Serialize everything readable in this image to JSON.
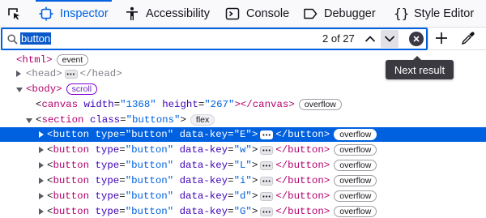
{
  "tabs": [
    {
      "label": "Inspector",
      "icon": "inspector-icon",
      "selected": true
    },
    {
      "label": "Accessibility",
      "icon": "accessibility-icon",
      "selected": false
    },
    {
      "label": "Console",
      "icon": "console-icon",
      "selected": false
    },
    {
      "label": "Debugger",
      "icon": "debugger-icon",
      "selected": false
    },
    {
      "label": "Style Editor",
      "icon": "style-editor-icon",
      "selected": false
    }
  ],
  "search": {
    "value": "button",
    "result_count": "2 of 27"
  },
  "tooltip": {
    "text": "Next result"
  },
  "markup": {
    "html_open": "<html>",
    "html_badge": "event",
    "head_open": "<head>",
    "head_close": "</head>",
    "body_open": "<body>",
    "body_badge": "scroll",
    "canvas": {
      "tag": "canvas",
      "width_attr": "width",
      "width_val": "\"1368\"",
      "height_attr": "height",
      "height_val": "\"267\"",
      "close": "></canvas>",
      "badge": "overflow"
    },
    "section": {
      "tag": "section",
      "class_attr": "class",
      "class_val": "\"buttons\"",
      "badge": "flex"
    },
    "button_rows": [
      {
        "key": "\"E\"",
        "badge": "overflow",
        "selected": true
      },
      {
        "key": "\"w\"",
        "badge": "overflow",
        "selected": false
      },
      {
        "key": "\"L\"",
        "badge": "overflow",
        "selected": false
      },
      {
        "key": "\"i\"",
        "badge": "overflow",
        "selected": false
      },
      {
        "key": "\"d\"",
        "badge": "overflow",
        "selected": false
      },
      {
        "key": "\"G\"",
        "badge": "overflow",
        "selected": false
      }
    ],
    "button": {
      "tag": "button",
      "type_attr": "type",
      "type_val": "\"button\"",
      "key_attr": "data-key",
      "close": "</button>"
    }
  },
  "colors": {
    "accent": "#0061e0",
    "tag": "#b4006d",
    "attr": "#3d00b8",
    "scroll_badge": "#8000d7"
  }
}
